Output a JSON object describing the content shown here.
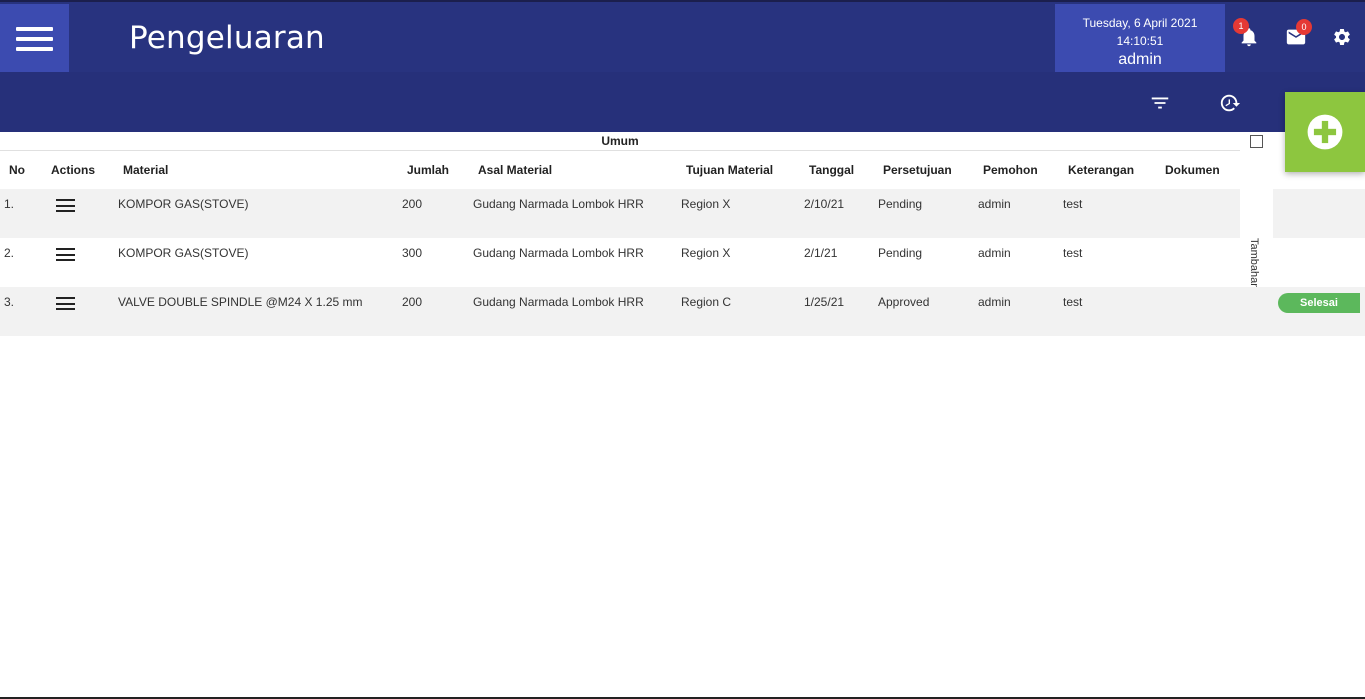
{
  "header": {
    "title": "Pengeluaran",
    "date": "Tuesday, 6 April 2021",
    "time": "14:10:51",
    "user": "admin",
    "notifications_count": "1",
    "messages_count": "0",
    "icons": [
      "menu-icon",
      "bell-icon",
      "mail-icon",
      "gear-icon",
      "filter-icon",
      "refresh-icon",
      "add-icon"
    ]
  },
  "table": {
    "group_header": "Umum",
    "side_label": "Tambahan",
    "columns": {
      "no": "No",
      "actions": "Actions",
      "material": "Material",
      "jumlah": "Jumlah",
      "asal": "Asal Material",
      "tujuan": "Tujuan Material",
      "tanggal": "Tanggal",
      "persetujuan": "Persetujuan",
      "pemohon": "Pemohon",
      "keterangan": "Keterangan",
      "dokumen": "Dokumen"
    },
    "rows": [
      {
        "no": "1.",
        "material": "KOMPOR GAS(STOVE)",
        "jumlah": "200",
        "asal": "Gudang Narmada Lombok HRR",
        "tujuan": "Region X",
        "tanggal": "2/10/21",
        "persetujuan": "Pending",
        "pemohon": "admin",
        "keterangan": "test"
      },
      {
        "no": "2.",
        "material": "KOMPOR GAS(STOVE)",
        "jumlah": "300",
        "asal": "Gudang Narmada Lombok HRR",
        "tujuan": "Region X",
        "tanggal": "2/1/21",
        "persetujuan": "Pending",
        "pemohon": "admin",
        "keterangan": "test"
      },
      {
        "no": "3.",
        "material": "VALVE DOUBLE SPINDLE @M24 X 1.25 mm",
        "jumlah": "200",
        "asal": "Gudang Narmada Lombok HRR",
        "tujuan": "Region C",
        "tanggal": "1/25/21",
        "persetujuan": "Approved",
        "pemohon": "admin",
        "keterangan": "test"
      }
    ],
    "row3_status": "Selesai"
  },
  "colors": {
    "topbar": "#28337f",
    "accent_blue": "#3c4bb0",
    "add_button": "#8dc63f",
    "status_green": "#5cb85c",
    "badge_red": "#e53935"
  }
}
